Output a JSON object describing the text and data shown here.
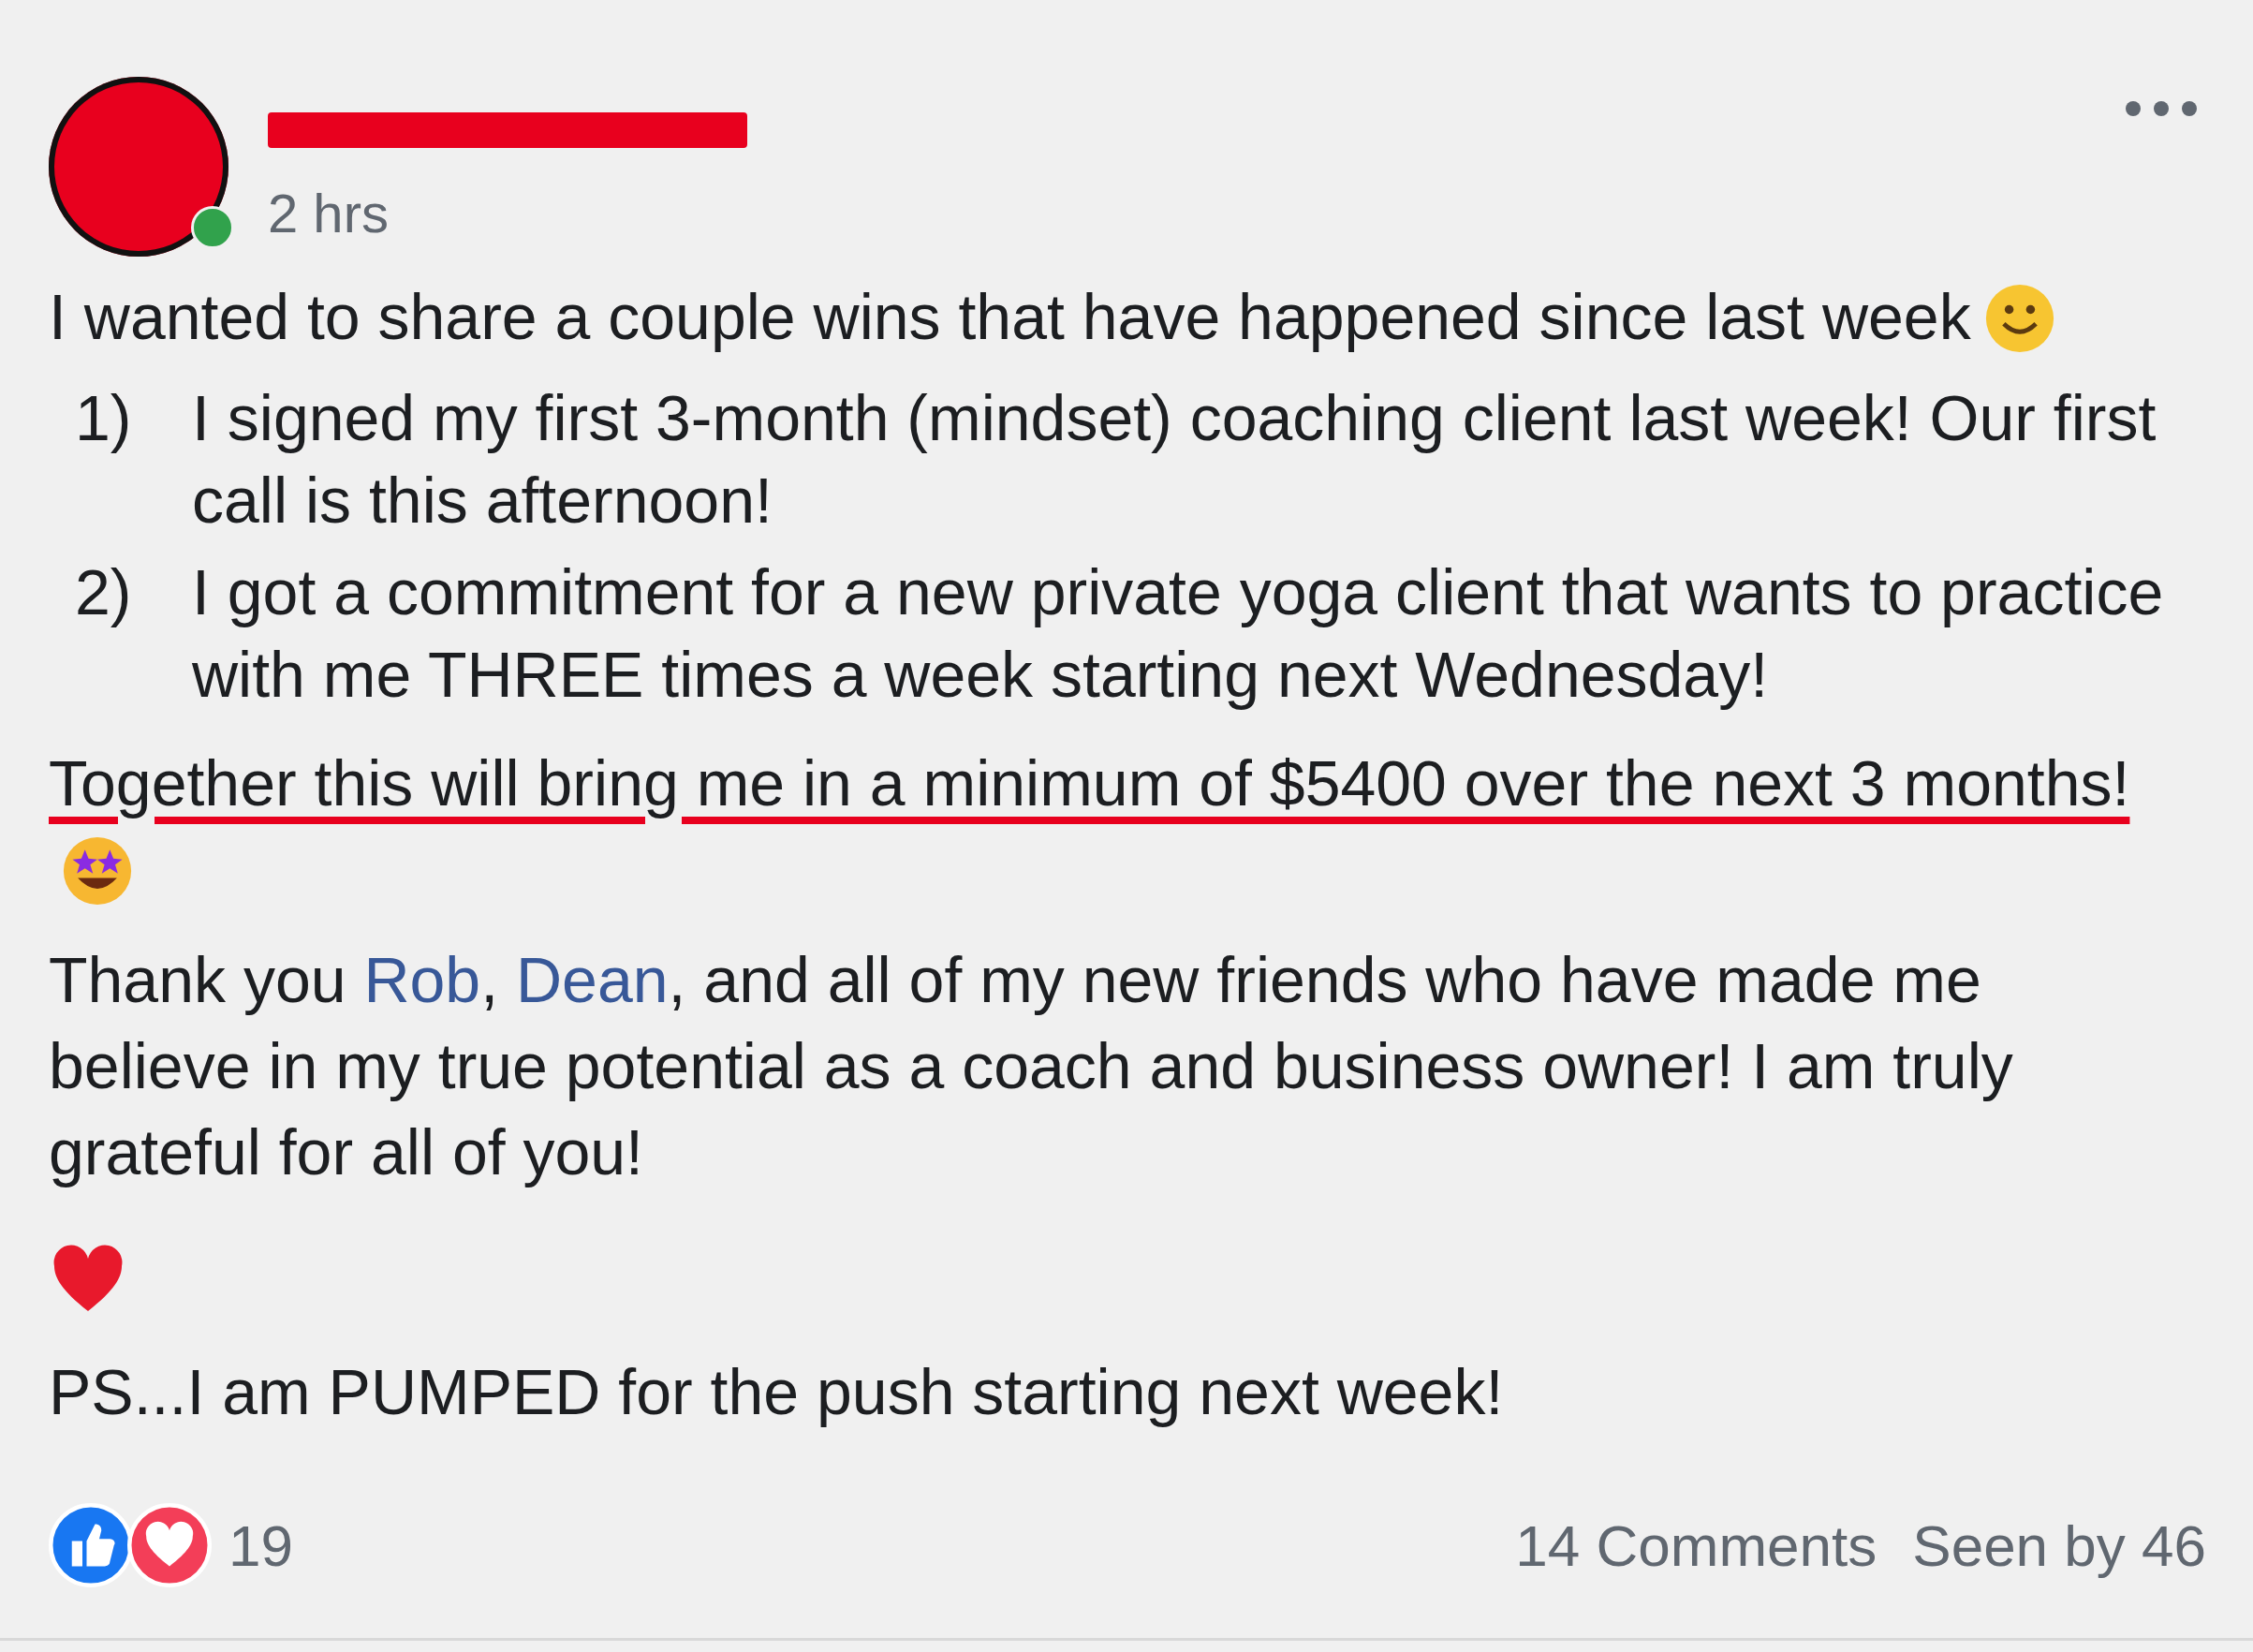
{
  "post": {
    "author": {
      "redacted": true,
      "online": true
    },
    "time": "2 hrs",
    "body": [
      {
        "kind": "text",
        "segments": [
          {
            "text": "I wanted to share a couple wins that have happened since last week"
          }
        ],
        "emoji": {
          "kind": "smile"
        }
      },
      {
        "kind": "list",
        "items": [
          {
            "number": "1)",
            "text": "I signed my first 3-month (mindset) coaching client last week! Our first call is this afternoon!"
          },
          {
            "number": "2)",
            "text": "I got a commitment for a new private yoga client that wants to practice with me THREE times a week starting next Wednesday!"
          }
        ]
      },
      {
        "kind": "text",
        "underlined": true,
        "segments": [
          {
            "text": "Together this will bring me in a minimum of $5400 over the next 3 months!"
          }
        ],
        "emoji": {
          "kind": "star-struck"
        }
      },
      {
        "kind": "text",
        "segments": [
          {
            "text": "Thank you "
          },
          {
            "text": "Rob",
            "link": true
          },
          {
            "text": ", "
          },
          {
            "text": "Dean",
            "link": true
          },
          {
            "text": ", and all of my new friends who have made me believe in my true potential as a coach and business owner! I am truly grateful for all of you!"
          }
        ]
      },
      {
        "kind": "emoji",
        "emoji": {
          "kind": "heart"
        }
      },
      {
        "kind": "text",
        "segments": [
          {
            "text": "PS...I am PUMPED for the push starting next week!"
          }
        ]
      }
    ],
    "reactions": {
      "types": [
        {
          "kind": "like"
        },
        {
          "kind": "love"
        }
      ],
      "count": "19"
    },
    "comments": "14 Comments",
    "seen": "Seen by 46"
  }
}
